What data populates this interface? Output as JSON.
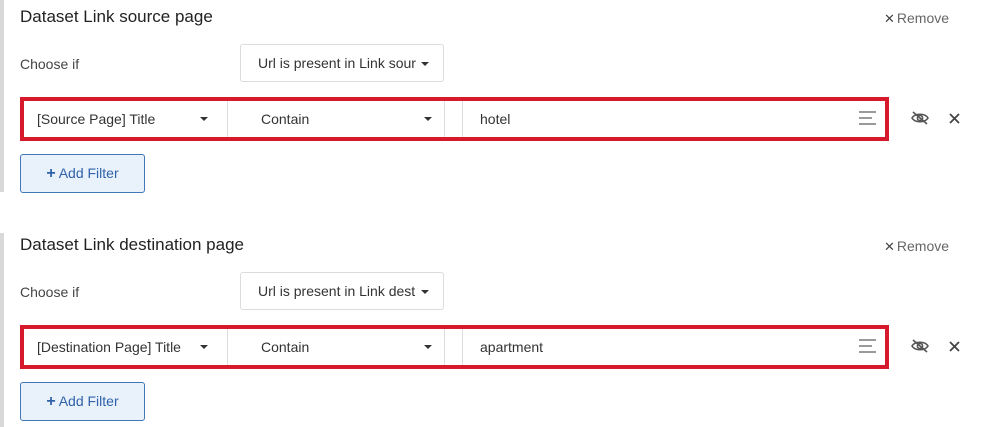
{
  "sections": [
    {
      "title": "Dataset Link source page",
      "remove_label": "Remove",
      "choose_label": "Choose if",
      "choose_value": "Url is present in Link source page",
      "filter": {
        "field": "[Source Page] Title",
        "operator": "Contain",
        "value": "hotel"
      },
      "add_filter_label": "Add Filter"
    },
    {
      "title": "Dataset Link destination page",
      "remove_label": "Remove",
      "choose_label": "Choose if",
      "choose_value": "Url is present in Link destination page",
      "filter": {
        "field": "[Destination Page] Title",
        "operator": "Contain",
        "value": "apartment"
      },
      "add_filter_label": "Add Filter"
    }
  ],
  "icons": {
    "remove": "close-icon",
    "dropdown": "caret-down-icon",
    "value_menu": "lines-icon",
    "visibility": "eye-slash-icon",
    "delete": "close-icon",
    "add": "plus-icon"
  },
  "colors": {
    "highlight": "#d7192c",
    "button_border": "#3f77b8",
    "button_bg": "#e9f1fb",
    "button_text": "#2f62a8"
  }
}
